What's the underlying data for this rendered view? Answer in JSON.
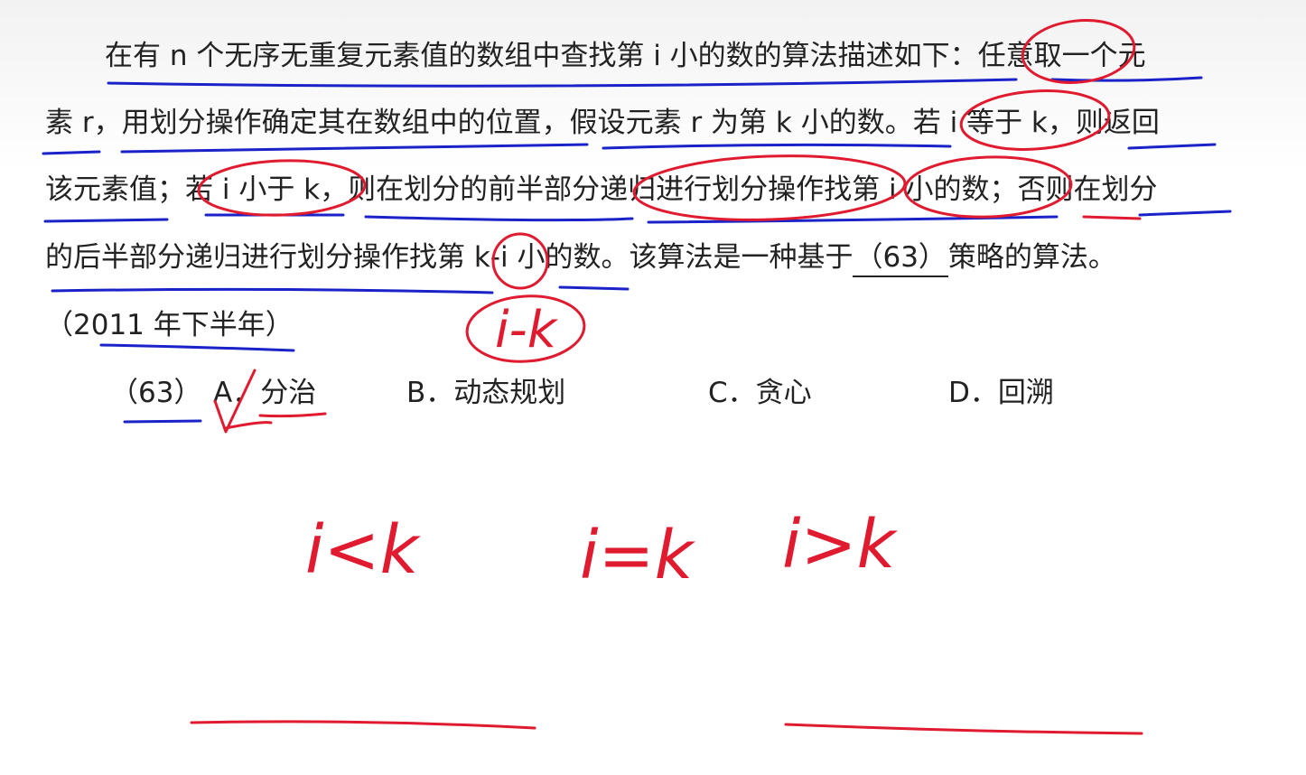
{
  "question": {
    "line1": "在有 n 个无序无重复元素值的数组中查找第 i 小的数的算法描述如下：任意取一个元",
    "line2": "素 r，用划分操作确定其在数组中的位置，假设元素 r 为第 k 小的数。若 i 等于 k，则返回",
    "line3": "该元素值；若 i 小于 k，则在划分的前半部分递归进行划分操作找第 i 小的数；否则在划分",
    "line4_before": "的后半部分递归进行划分操作找第 k-i 小的数。该算法是一种基于",
    "blank": "（63）",
    "line4_after": "策略的算法。",
    "source": "（2011 年下半年）"
  },
  "options": {
    "number": "（63）",
    "a": "A．分治",
    "b": "B．动态规划",
    "c": "C．贪心",
    "d": "D．回溯"
  },
  "annotations": {
    "correction": "i-k",
    "case1": "i<k",
    "case2": "i=k",
    "case3": "i>k",
    "ink_colors": {
      "red": "#e01b2f",
      "blue": "#1a22c8"
    }
  }
}
